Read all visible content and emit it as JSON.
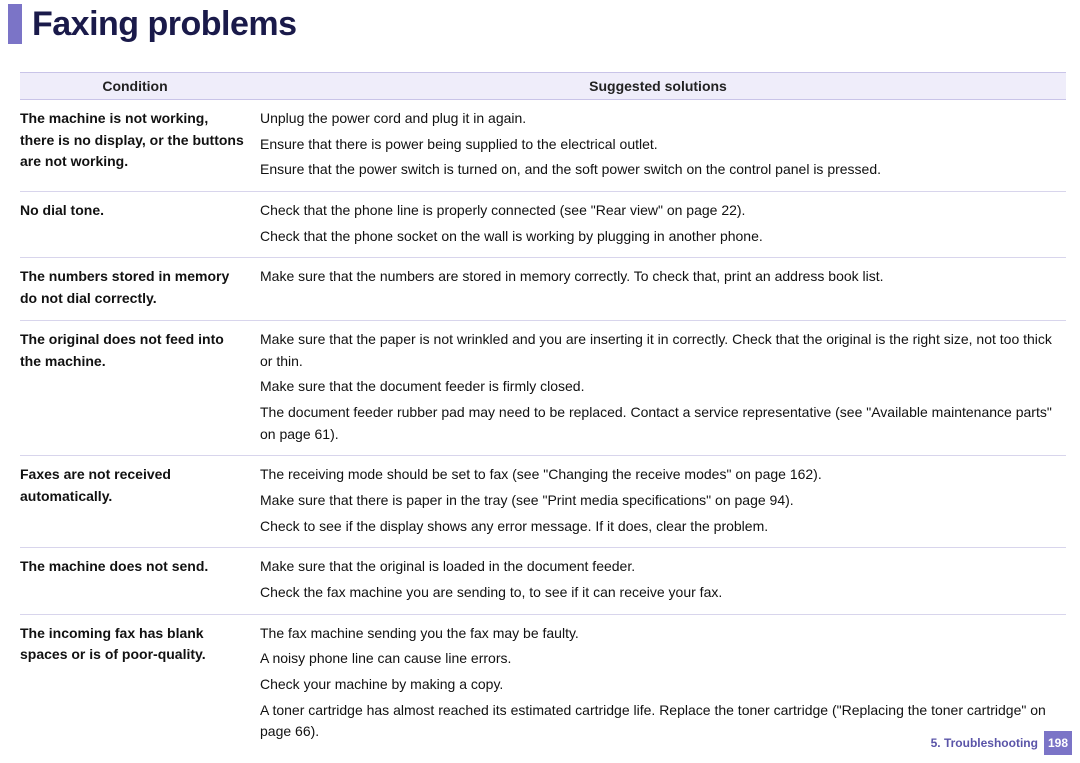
{
  "title": "Faxing problems",
  "columns": {
    "condition": "Condition",
    "solutions": "Suggested solutions"
  },
  "rows": [
    {
      "condition": "The machine is not working, there is no display, or the buttons are not working.",
      "solutions": [
        "Unplug the power cord and plug it in again.",
        "Ensure that there is power being supplied to the electrical outlet.",
        "Ensure that the power switch is turned on, and the soft power switch on the control panel is pressed."
      ]
    },
    {
      "condition": "No dial tone.",
      "solutions": [
        "Check that the phone line is properly connected (see \"Rear view\" on page 22).",
        "Check that the phone socket on the wall is working by plugging in another phone."
      ]
    },
    {
      "condition": "The numbers stored in memory do not dial correctly.",
      "solutions": [
        "Make sure that the numbers are stored in memory correctly. To check that, print an address book list."
      ]
    },
    {
      "condition": "The original does not feed into the machine.",
      "solutions": [
        "Make sure that the paper is not wrinkled and you are inserting it in correctly. Check that the original is the right size, not too thick or thin.",
        "Make sure that the document feeder is firmly closed.",
        "The document feeder rubber pad may need to be replaced. Contact a service representative (see \"Available maintenance parts\" on page 61)."
      ]
    },
    {
      "condition": "Faxes are not received automatically.",
      "solutions": [
        "The receiving mode should be set to fax (see \"Changing the receive modes\" on page 162).",
        "Make sure that there is paper in the tray (see \"Print media specifications\" on page 94).",
        "Check to see if the display shows any error message. If it does, clear the problem."
      ]
    },
    {
      "condition": "The machine does not send.",
      "solutions": [
        "Make sure that the original is loaded in the document feeder.",
        "Check the fax machine you are sending to, to see if it can receive your fax."
      ]
    },
    {
      "condition": "The incoming fax has blank spaces or is of poor-quality.",
      "solutions": [
        "The fax machine sending you the fax may be faulty.",
        "A noisy phone line can cause line errors.",
        "Check your machine by making a copy.",
        "A toner cartridge has almost reached its estimated cartridge life. Replace the toner cartridge (\"Replacing the toner cartridge\" on page 66)."
      ]
    }
  ],
  "footer": {
    "chapter": "5.  Troubleshooting",
    "page": "198"
  }
}
